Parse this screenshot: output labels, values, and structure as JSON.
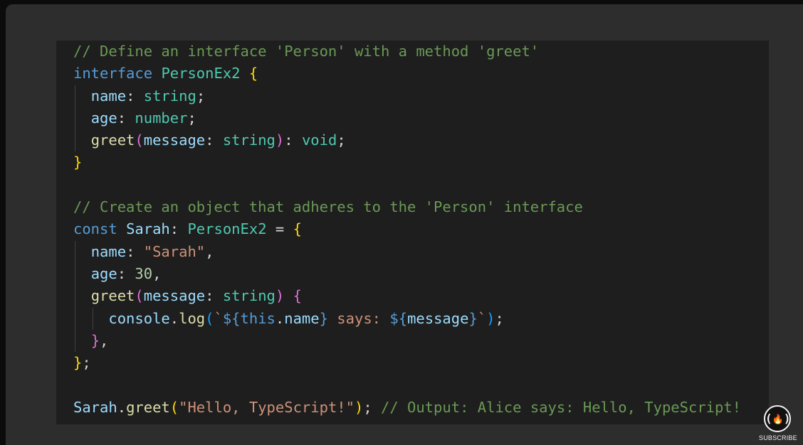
{
  "code": {
    "lines": [
      [
        {
          "t": "// Define an interface 'Person' with a method 'greet'",
          "c": "c-comment"
        }
      ],
      [
        {
          "t": "interface",
          "c": "c-keyword"
        },
        {
          "t": " ",
          "c": "c-punct"
        },
        {
          "t": "PersonEx2",
          "c": "c-type"
        },
        {
          "t": " ",
          "c": "c-punct"
        },
        {
          "t": "{",
          "c": "c-brace1"
        }
      ],
      [
        {
          "t": "  ",
          "c": "c-punct"
        },
        {
          "t": "name",
          "c": "c-prop"
        },
        {
          "t": ": ",
          "c": "c-punct"
        },
        {
          "t": "string",
          "c": "c-type"
        },
        {
          "t": ";",
          "c": "c-punct"
        }
      ],
      [
        {
          "t": "  ",
          "c": "c-punct"
        },
        {
          "t": "age",
          "c": "c-prop"
        },
        {
          "t": ": ",
          "c": "c-punct"
        },
        {
          "t": "number",
          "c": "c-type"
        },
        {
          "t": ";",
          "c": "c-punct"
        }
      ],
      [
        {
          "t": "  ",
          "c": "c-punct"
        },
        {
          "t": "greet",
          "c": "c-func"
        },
        {
          "t": "(",
          "c": "c-brace2"
        },
        {
          "t": "message",
          "c": "c-var"
        },
        {
          "t": ": ",
          "c": "c-punct"
        },
        {
          "t": "string",
          "c": "c-type"
        },
        {
          "t": ")",
          "c": "c-brace2"
        },
        {
          "t": ": ",
          "c": "c-punct"
        },
        {
          "t": "void",
          "c": "c-type"
        },
        {
          "t": ";",
          "c": "c-punct"
        }
      ],
      [
        {
          "t": "}",
          "c": "c-brace1"
        }
      ],
      [],
      [
        {
          "t": "// Create an object that adheres to the 'Person' interface",
          "c": "c-comment"
        }
      ],
      [
        {
          "t": "const",
          "c": "c-keyword"
        },
        {
          "t": " ",
          "c": "c-punct"
        },
        {
          "t": "Sarah",
          "c": "c-var"
        },
        {
          "t": ": ",
          "c": "c-punct"
        },
        {
          "t": "PersonEx2",
          "c": "c-type"
        },
        {
          "t": " = ",
          "c": "c-punct"
        },
        {
          "t": "{",
          "c": "c-brace1"
        }
      ],
      [
        {
          "t": "  ",
          "c": "c-punct"
        },
        {
          "t": "name",
          "c": "c-prop"
        },
        {
          "t": ": ",
          "c": "c-punct"
        },
        {
          "t": "\"Sarah\"",
          "c": "c-string"
        },
        {
          "t": ",",
          "c": "c-punct"
        }
      ],
      [
        {
          "t": "  ",
          "c": "c-punct"
        },
        {
          "t": "age",
          "c": "c-prop"
        },
        {
          "t": ": ",
          "c": "c-punct"
        },
        {
          "t": "30",
          "c": "c-number"
        },
        {
          "t": ",",
          "c": "c-punct"
        }
      ],
      [
        {
          "t": "  ",
          "c": "c-punct"
        },
        {
          "t": "greet",
          "c": "c-func"
        },
        {
          "t": "(",
          "c": "c-brace2"
        },
        {
          "t": "message",
          "c": "c-var"
        },
        {
          "t": ": ",
          "c": "c-punct"
        },
        {
          "t": "string",
          "c": "c-type"
        },
        {
          "t": ")",
          "c": "c-brace2"
        },
        {
          "t": " ",
          "c": "c-punct"
        },
        {
          "t": "{",
          "c": "c-brace2"
        }
      ],
      [
        {
          "t": "    ",
          "c": "c-punct"
        },
        {
          "t": "console",
          "c": "c-var"
        },
        {
          "t": ".",
          "c": "c-punct"
        },
        {
          "t": "log",
          "c": "c-func"
        },
        {
          "t": "(",
          "c": "c-brace3"
        },
        {
          "t": "`",
          "c": "c-string"
        },
        {
          "t": "${",
          "c": "c-tmpl"
        },
        {
          "t": "this",
          "c": "c-keyword"
        },
        {
          "t": ".",
          "c": "c-punct"
        },
        {
          "t": "name",
          "c": "c-var"
        },
        {
          "t": "}",
          "c": "c-tmpl"
        },
        {
          "t": " says: ",
          "c": "c-string"
        },
        {
          "t": "${",
          "c": "c-tmpl"
        },
        {
          "t": "message",
          "c": "c-var"
        },
        {
          "t": "}",
          "c": "c-tmpl"
        },
        {
          "t": "`",
          "c": "c-string"
        },
        {
          "t": ")",
          "c": "c-brace3"
        },
        {
          "t": ";",
          "c": "c-punct"
        }
      ],
      [
        {
          "t": "  ",
          "c": "c-punct"
        },
        {
          "t": "}",
          "c": "c-brace2"
        },
        {
          "t": ",",
          "c": "c-punct"
        }
      ],
      [
        {
          "t": "}",
          "c": "c-brace1"
        },
        {
          "t": ";",
          "c": "c-punct"
        }
      ],
      [],
      [
        {
          "t": "Sarah",
          "c": "c-var"
        },
        {
          "t": ".",
          "c": "c-punct"
        },
        {
          "t": "greet",
          "c": "c-func"
        },
        {
          "t": "(",
          "c": "c-brace1"
        },
        {
          "t": "\"Hello, TypeScript!\"",
          "c": "c-string"
        },
        {
          "t": ")",
          "c": "c-brace1"
        },
        {
          "t": "; ",
          "c": "c-punct"
        },
        {
          "t": "// Output: Alice says: Hello, TypeScript!",
          "c": "c-comment"
        }
      ]
    ],
    "indent_guides": [
      {
        "line": 2,
        "levels": [
          0
        ]
      },
      {
        "line": 3,
        "levels": [
          0
        ]
      },
      {
        "line": 4,
        "levels": [
          0
        ]
      },
      {
        "line": 9,
        "levels": [
          0
        ]
      },
      {
        "line": 10,
        "levels": [
          0
        ]
      },
      {
        "line": 11,
        "levels": [
          0
        ]
      },
      {
        "line": 12,
        "levels": [
          0,
          1
        ]
      },
      {
        "line": 13,
        "levels": [
          0
        ]
      }
    ]
  },
  "logo": {
    "icon": "freecodecamp-flame-icon",
    "glyph": "(🔥)",
    "subscribe_label": "SUBSCRIBE"
  }
}
